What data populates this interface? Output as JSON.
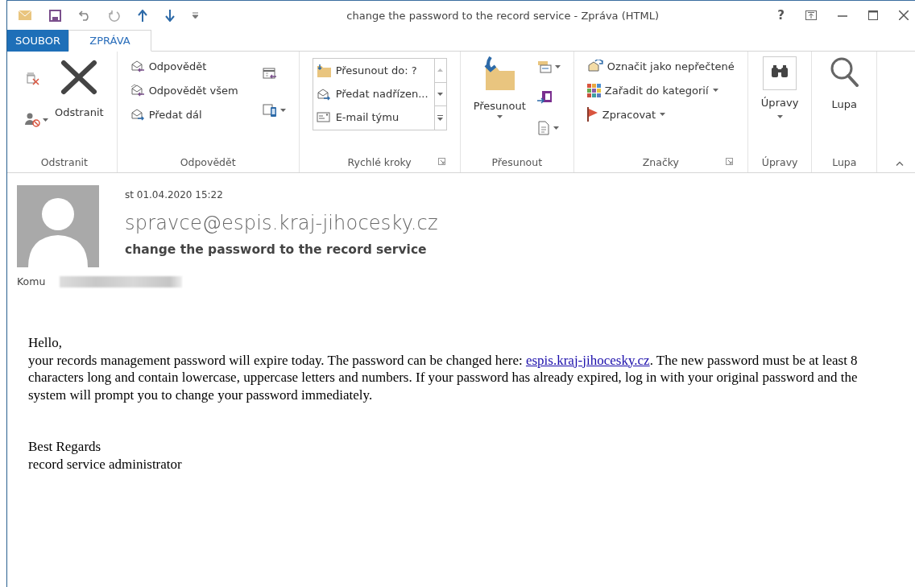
{
  "window": {
    "title": "change the password to the record service - Zpráva (HTML)",
    "help": "?"
  },
  "tabs": [
    {
      "label": "SOUBOR",
      "kind": "file",
      "selected": false
    },
    {
      "label": "ZPRÁVA",
      "kind": "tab",
      "selected": true
    }
  ],
  "ribbon": {
    "groups": [
      {
        "label": "Odstranit",
        "items": [
          "Odstranit"
        ]
      },
      {
        "label": "Odpovědět",
        "items": [
          "Odpovědět",
          "Odpovědět všem",
          "Předat dál"
        ]
      },
      {
        "label": "Rychlé kroky",
        "items": [
          "Přesunout do: ?",
          "Předat nadřízen...",
          "E-mail týmu"
        ]
      },
      {
        "label": "Přesunout",
        "items": [
          "Přesunout"
        ]
      },
      {
        "label": "Značky",
        "items": [
          "Označit jako nepřečtené",
          "Zařadit do kategorií",
          "Zpracovat"
        ]
      },
      {
        "label": "Úpravy",
        "items": [
          "Úpravy"
        ]
      },
      {
        "label": "Lupa",
        "items": [
          "Lupa"
        ]
      }
    ]
  },
  "message": {
    "date": "st 01.04.2020 15:22",
    "sender": "spravce@espis.kraj-jihocesky.cz",
    "subject": "change the password to the record service",
    "to_label": "Komu"
  },
  "body": {
    "greeting": "Hello,",
    "paragraph": {
      "before": "your records management password will expire today. The password can be changed here: ",
      "link": "espis.kraj-jihocesky.cz",
      "after": ". The new password must be at least 8 characters long and contain lowercase, uppercase letters and numbers. If your password has already expired, log in with your original password and the system will prompt you to change your password immediately."
    },
    "closing": "Best Regards",
    "signature": "record service administrator"
  }
}
